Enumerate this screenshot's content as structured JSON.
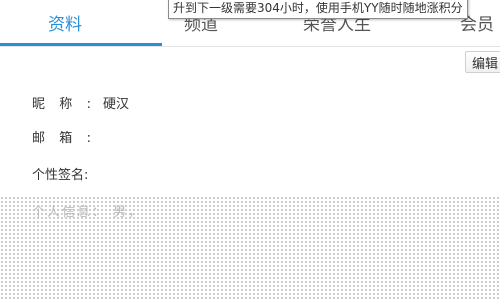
{
  "tabs": [
    {
      "label": "资料",
      "active": true
    },
    {
      "label": "频道",
      "active": false
    },
    {
      "label": "荣誉人生",
      "active": false
    },
    {
      "label": "会员",
      "active": false
    }
  ],
  "tooltip": {
    "text": "升到下一级需要304小时，使用手机YY随时随地涨积分"
  },
  "toolbar": {
    "edit_label": "编辑"
  },
  "profile": {
    "nickname_label": "昵称:",
    "nickname_value": "硬汉",
    "email_label": "邮箱:",
    "signature_label": "个性签名:",
    "info_partial_label": "个人信息： 男，"
  },
  "colors": {
    "accent": "#2b8fd6"
  }
}
